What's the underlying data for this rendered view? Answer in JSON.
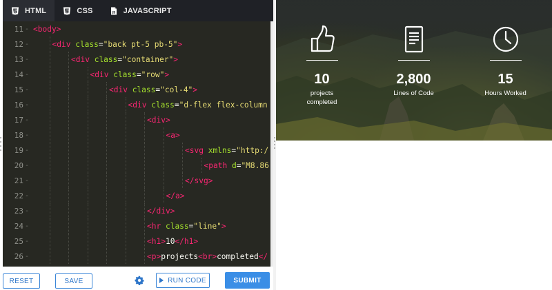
{
  "tabs": [
    {
      "label": "HTML",
      "icon": "html5-icon",
      "active": true
    },
    {
      "label": "CSS",
      "icon": "css3-icon",
      "active": false
    },
    {
      "label": "JAVASCRIPT",
      "icon": "js-file-icon",
      "active": false
    }
  ],
  "code_lines": [
    {
      "num": "11",
      "indent": 0,
      "html": "<span class='tag'>&lt;body&gt;</span>"
    },
    {
      "num": "12",
      "indent": 1,
      "html": "<span class='tag'>&lt;div</span> <span class='attr'>class</span>=<span class='str'>\"back pt-5 pb-5\"</span><span class='tag'>&gt;</span>"
    },
    {
      "num": "13",
      "indent": 2,
      "html": "<span class='tag'>&lt;div</span> <span class='attr'>class</span>=<span class='str'>\"container\"</span><span class='tag'>&gt;</span>"
    },
    {
      "num": "14",
      "indent": 3,
      "html": "<span class='tag'>&lt;div</span> <span class='attr'>class</span>=<span class='str'>\"row\"</span><span class='tag'>&gt;</span>"
    },
    {
      "num": "15",
      "indent": 4,
      "html": "<span class='tag'>&lt;div</span> <span class='attr'>class</span>=<span class='str'>\"col-4\"</span><span class='tag'>&gt;</span>"
    },
    {
      "num": "16",
      "indent": 5,
      "html": "<span class='tag'>&lt;div</span> <span class='attr'>class</span>=<span class='str'>\"d-flex flex-column</span>"
    },
    {
      "num": "17",
      "indent": 6,
      "html": "<span class='tag'>&lt;div&gt;</span>"
    },
    {
      "num": "18",
      "indent": 7,
      "html": "<span class='tag'>&lt;a&gt;</span>"
    },
    {
      "num": "19",
      "indent": 8,
      "html": "<span class='tag'>&lt;svg</span> <span class='attr'>xmlns</span>=<span class='str'>\"http:/</span>"
    },
    {
      "num": "20",
      "indent": 9,
      "html": "<span class='tag'>&lt;path</span> <span class='attr'>d</span>=<span class='str'>\"M8.86</span>"
    },
    {
      "num": "21",
      "indent": 8,
      "html": "<span class='tag'>&lt;/svg&gt;</span>"
    },
    {
      "num": "22",
      "indent": 7,
      "html": "<span class='tag'>&lt;/a&gt;</span>"
    },
    {
      "num": "23",
      "indent": 6,
      "html": "<span class='tag'>&lt;/div&gt;</span>"
    },
    {
      "num": "24",
      "indent": 6,
      "html": "<span class='tag'>&lt;hr</span> <span class='attr'>class</span>=<span class='str'>\"line\"</span><span class='tag'>&gt;</span>"
    },
    {
      "num": "25",
      "indent": 6,
      "html": "<span class='tag'>&lt;h1&gt;</span><span class='txt'>10</span><span class='tag'>&lt;/h1&gt;</span>"
    },
    {
      "num": "26",
      "indent": 6,
      "html": "<span class='tag'>&lt;p&gt;</span><span class='txt'>projects</span><span class='tag'>&lt;br&gt;</span><span class='txt'>completed</span><span class='tag'>&lt;/</span>"
    }
  ],
  "buttons": {
    "reset": "RESET",
    "save": "SAVE",
    "run_code": "RUN CODE",
    "submit": "SUBMIT"
  },
  "stats": [
    {
      "icon": "thumbs-up-icon",
      "number": "10",
      "label_line1": "projects",
      "label_line2": "completed"
    },
    {
      "icon": "document-icon",
      "number": "2,800",
      "label_line1": "Lines of Code",
      "label_line2": ""
    },
    {
      "icon": "clock-icon",
      "number": "15",
      "label_line1": "Hours Worked",
      "label_line2": ""
    }
  ],
  "colors": {
    "accent": "#3a8ee6",
    "editor_bg": "#272822",
    "tabbar_bg": "#1f2126",
    "tag": "#f92672",
    "attr": "#a6e22e",
    "string": "#e6db74"
  }
}
